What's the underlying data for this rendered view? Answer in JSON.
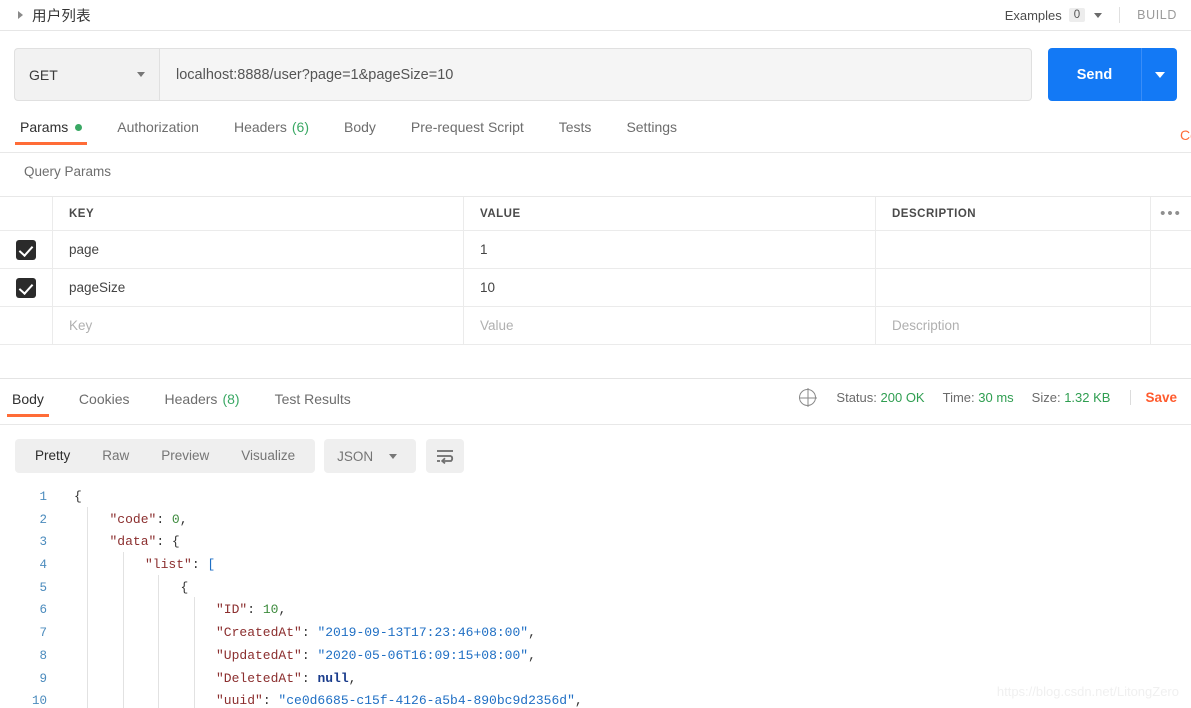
{
  "request_bar": {
    "name": "用户列表",
    "collapse_icon": "triangle-right-icon",
    "examples_label": "Examples",
    "examples_count": "0",
    "examples_caret": "chevron-down-icon",
    "build_label": "BUILD"
  },
  "url_row": {
    "method": "GET",
    "method_caret": "chevron-down-icon",
    "url": "localhost:8888/user?page=1&pageSize=10",
    "send_label": "Send",
    "send_caret": "chevron-down-icon",
    "send_color": "#1379f5"
  },
  "request_tabs": {
    "active_underline_color": "#ff6c37",
    "items": [
      {
        "label": "Params",
        "badge": "",
        "dot": true,
        "active": true
      },
      {
        "label": "Authorization",
        "badge": "",
        "dot": false,
        "active": false
      },
      {
        "label": "Headers",
        "badge": "(6)",
        "dot": false,
        "active": false
      },
      {
        "label": "Body",
        "badge": "",
        "dot": false,
        "active": false
      },
      {
        "label": "Pre-request Script",
        "badge": "",
        "dot": false,
        "active": false
      },
      {
        "label": "Tests",
        "badge": "",
        "dot": false,
        "active": false
      },
      {
        "label": "Settings",
        "badge": "",
        "dot": false,
        "active": false
      }
    ],
    "cookies_partial": "Cookies"
  },
  "query_params": {
    "section_title": "Query Params",
    "columns": [
      "KEY",
      "VALUE",
      "DESCRIPTION"
    ],
    "more_icon": "ellipsis-icon",
    "rows": [
      {
        "checked": true,
        "key": "page",
        "value": "1",
        "description": ""
      },
      {
        "checked": true,
        "key": "pageSize",
        "value": "10",
        "description": ""
      }
    ],
    "placeholder_row": {
      "key": "Key",
      "value": "Value",
      "description": "Description"
    }
  },
  "response": {
    "tabs": [
      {
        "label": "Body",
        "badge": "",
        "active": true
      },
      {
        "label": "Cookies",
        "badge": "",
        "active": false
      },
      {
        "label": "Headers",
        "badge": "(8)",
        "active": false
      },
      {
        "label": "Test Results",
        "badge": "",
        "active": false
      }
    ],
    "globe_icon": "globe-icon",
    "status_label": "Status:",
    "status_value": "200 OK",
    "time_label": "Time:",
    "time_value": "30 ms",
    "size_label": "Size:",
    "size_value": "1.32 KB",
    "save_label": "Save",
    "status_color": "#2f9e51",
    "save_color": "#ff5b2e"
  },
  "body_toolbar": {
    "views": [
      {
        "label": "Pretty",
        "active": true
      },
      {
        "label": "Raw",
        "active": false
      },
      {
        "label": "Preview",
        "active": false
      },
      {
        "label": "Visualize",
        "active": false
      }
    ],
    "format": "JSON",
    "format_caret": "chevron-down-icon",
    "wrap_icon": "word-wrap-icon"
  },
  "code": {
    "lines": [
      {
        "no": "1",
        "indent": 0,
        "tokens": [
          {
            "t": "p",
            "v": "{"
          }
        ]
      },
      {
        "no": "2",
        "indent": 1,
        "tokens": [
          {
            "t": "k",
            "v": "\"code\""
          },
          {
            "t": "p",
            "v": ": "
          },
          {
            "t": "n",
            "v": "0"
          },
          {
            "t": "p",
            "v": ","
          }
        ]
      },
      {
        "no": "3",
        "indent": 1,
        "tokens": [
          {
            "t": "k",
            "v": "\"data\""
          },
          {
            "t": "p",
            "v": ": {"
          }
        ]
      },
      {
        "no": "4",
        "indent": 2,
        "tokens": [
          {
            "t": "k",
            "v": "\"list\""
          },
          {
            "t": "p",
            "v": ": "
          },
          {
            "t": "br",
            "v": "["
          }
        ]
      },
      {
        "no": "5",
        "indent": 3,
        "tokens": [
          {
            "t": "p",
            "v": "{"
          }
        ]
      },
      {
        "no": "6",
        "indent": 4,
        "tokens": [
          {
            "t": "k",
            "v": "\"ID\""
          },
          {
            "t": "p",
            "v": ": "
          },
          {
            "t": "n",
            "v": "10"
          },
          {
            "t": "p",
            "v": ","
          }
        ]
      },
      {
        "no": "7",
        "indent": 4,
        "tokens": [
          {
            "t": "k",
            "v": "\"CreatedAt\""
          },
          {
            "t": "p",
            "v": ": "
          },
          {
            "t": "s",
            "v": "\"2019-09-13T17:23:46+08:00\""
          },
          {
            "t": "p",
            "v": ","
          }
        ]
      },
      {
        "no": "8",
        "indent": 4,
        "tokens": [
          {
            "t": "k",
            "v": "\"UpdatedAt\""
          },
          {
            "t": "p",
            "v": ": "
          },
          {
            "t": "s",
            "v": "\"2020-05-06T16:09:15+08:00\""
          },
          {
            "t": "p",
            "v": ","
          }
        ]
      },
      {
        "no": "9",
        "indent": 4,
        "tokens": [
          {
            "t": "k",
            "v": "\"DeletedAt\""
          },
          {
            "t": "p",
            "v": ": "
          },
          {
            "t": "nl",
            "v": "null"
          },
          {
            "t": "p",
            "v": ","
          }
        ]
      },
      {
        "no": "10",
        "indent": 4,
        "tokens": [
          {
            "t": "k",
            "v": "\"uuid\""
          },
          {
            "t": "p",
            "v": ": "
          },
          {
            "t": "s",
            "v": "\"ce0d6685-c15f-4126-a5b4-890bc9d2356d\""
          },
          {
            "t": "p",
            "v": ","
          }
        ]
      }
    ]
  },
  "watermark": "https://blog.csdn.net/LitongZero"
}
